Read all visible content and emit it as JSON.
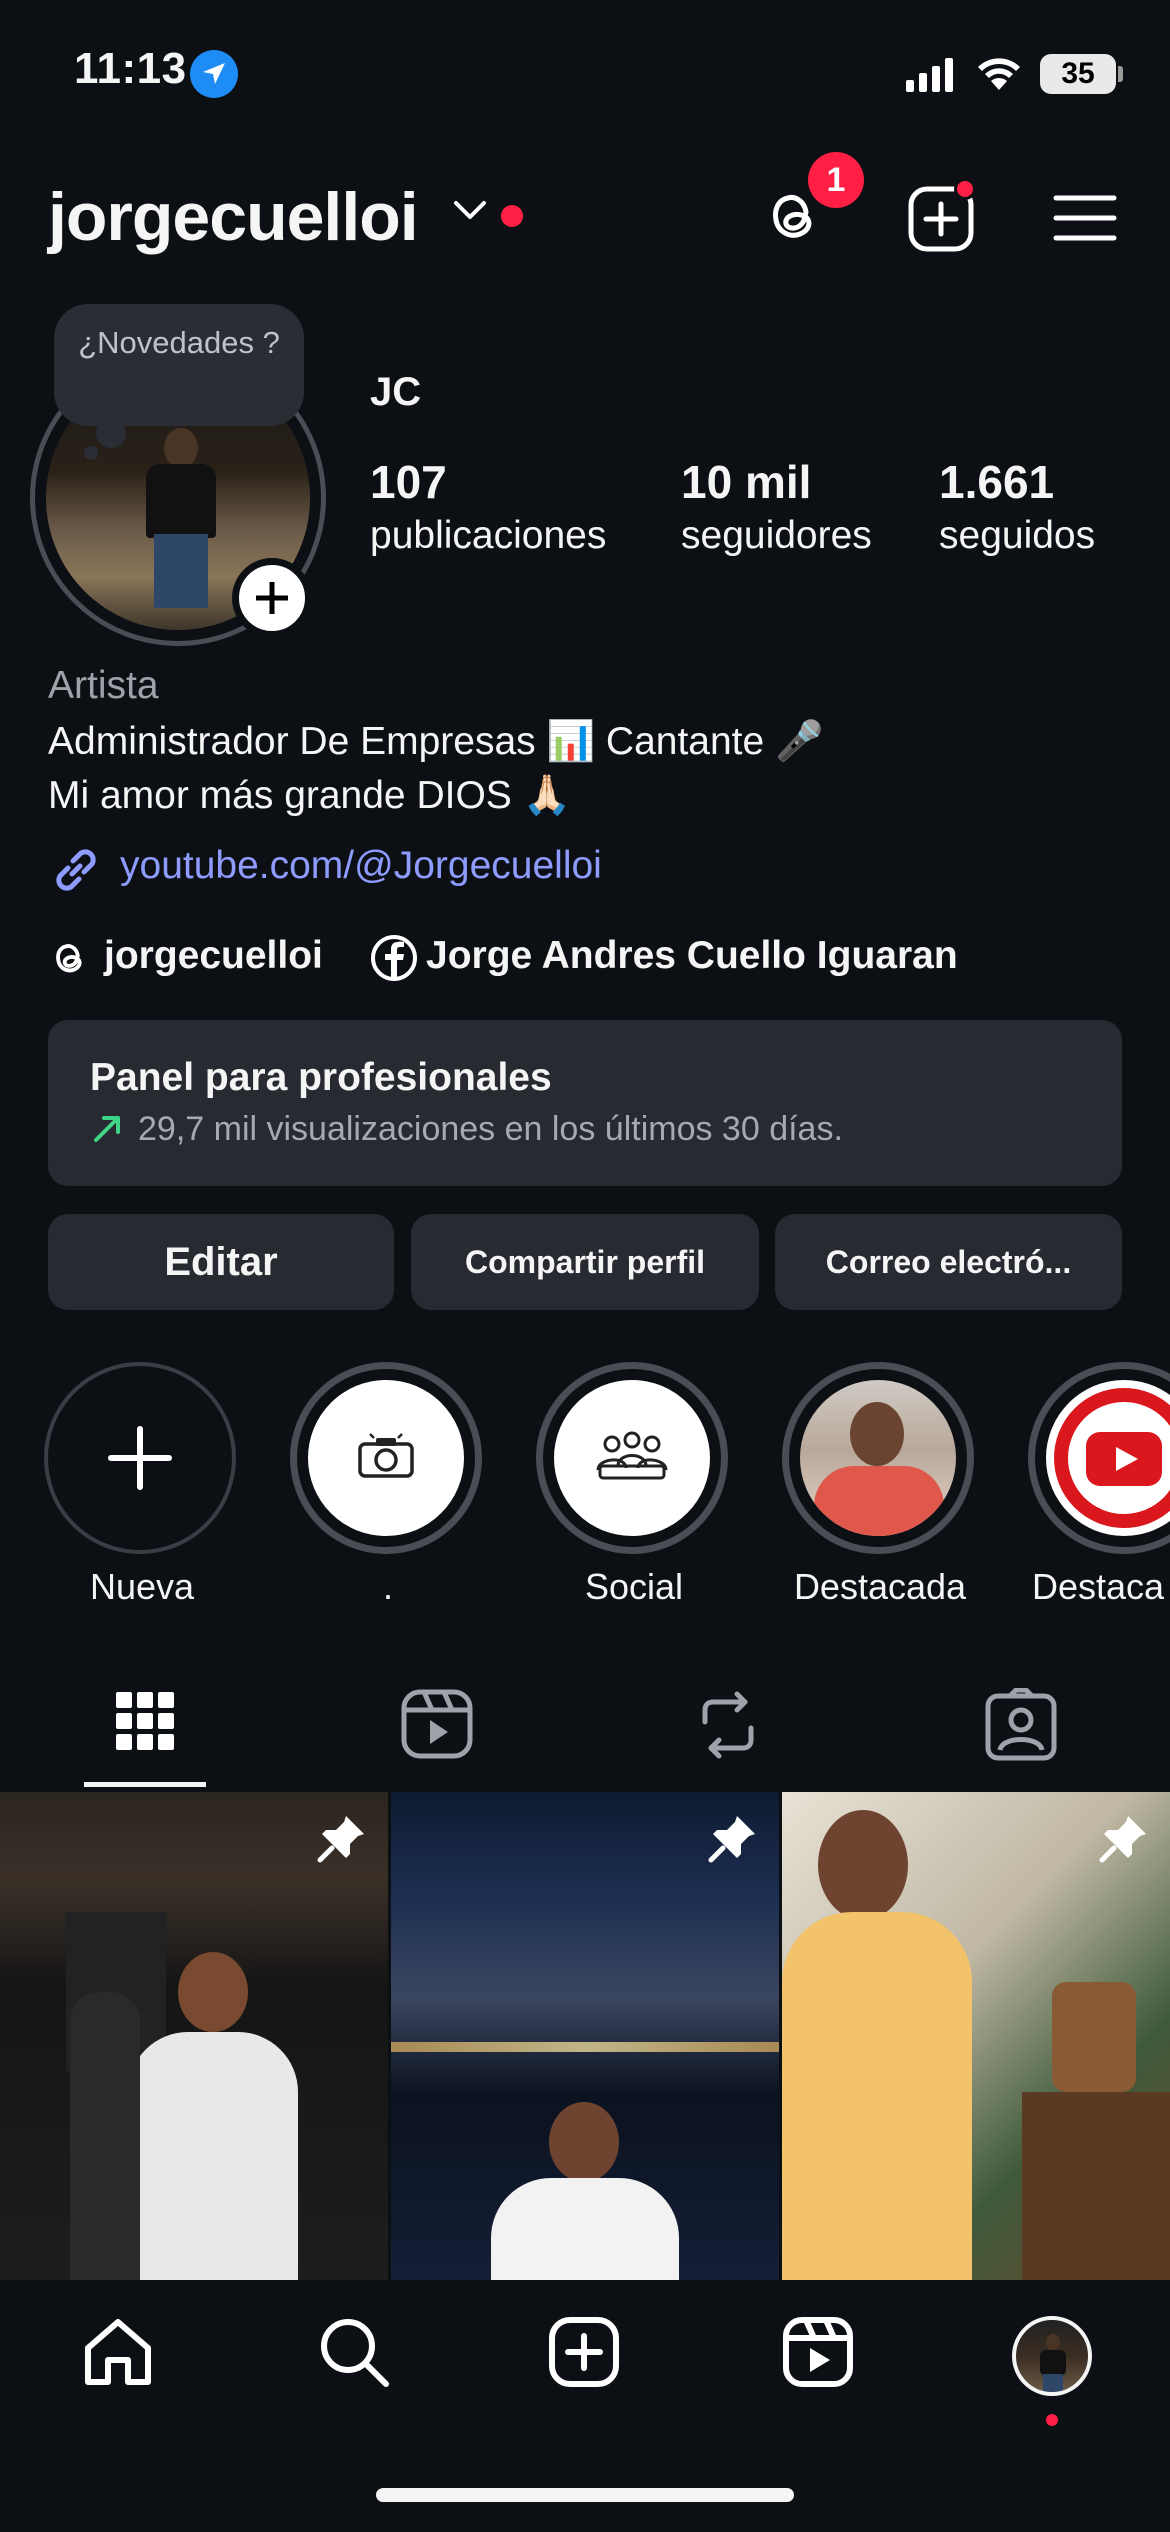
{
  "status_bar": {
    "time": "11:13",
    "battery": "35"
  },
  "header": {
    "username": "jorgecuelloi",
    "threads_badge": "1"
  },
  "profile": {
    "note_text": "¿Novedades ?",
    "display_name": "JC",
    "stats": [
      {
        "value": "107",
        "label": "publicaciones"
      },
      {
        "value": "10 mil",
        "label": "seguidores"
      },
      {
        "value": "1.661",
        "label": "seguidos"
      }
    ],
    "category": "Artista",
    "bio_lines": [
      "Administrador De Empresas 📊 Cantante 🎤",
      "Mi amor más grande DIOS 🙏🏻"
    ],
    "link": "youtube.com/@Jorgecuelloi",
    "threads_handle": "jorgecuelloi",
    "facebook_name": "Jorge Andres Cuello Iguaran"
  },
  "panel": {
    "title": "Panel para profesionales",
    "subtitle": "29,7 mil visualizaciones en los últimos 30 días."
  },
  "buttons": {
    "edit": "Editar",
    "share": "Compartir perfil",
    "email": "Correo electró..."
  },
  "highlights": [
    {
      "label": "Nueva",
      "icon": "plus-icon"
    },
    {
      "label": ".",
      "icon": "camera-icon"
    },
    {
      "label": "Social",
      "icon": "group-icon"
    },
    {
      "label": "Destacada",
      "icon": "photo"
    },
    {
      "label": "Destaca",
      "icon": "youtube-logo"
    }
  ],
  "tabs": [
    "grid-icon",
    "reels-icon",
    "reposts-icon",
    "tagged-icon"
  ],
  "nav": [
    "home-icon",
    "search-icon",
    "create-icon",
    "reels-icon",
    "profile-avatar"
  ],
  "colors": {
    "background": "#0c1015",
    "surface": "#272a30",
    "accent_red": "#ff1f45",
    "link": "#8e9bff",
    "location_blue": "#1e8cf5"
  }
}
